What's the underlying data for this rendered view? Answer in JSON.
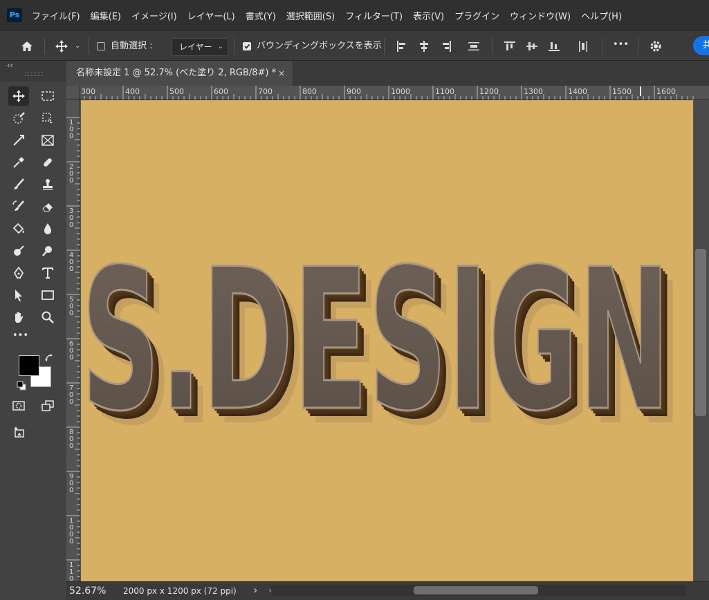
{
  "app": {
    "logo_text": "Ps"
  },
  "menu": [
    "ファイル(F)",
    "編集(E)",
    "イメージ(I)",
    "レイヤー(L)",
    "書式(Y)",
    "選択範囲(S)",
    "フィルター(T)",
    "表示(V)",
    "プラグイン",
    "ウィンドウ(W)",
    "ヘルプ(H)"
  ],
  "options": {
    "auto_select_label": "自動選択 :",
    "auto_select_checked": false,
    "layer_select_value": "レイヤー",
    "bounding_box_label": "バウンディングボックスを表示",
    "bounding_box_checked": true,
    "more_label": "•••",
    "share_label": "共"
  },
  "toolbar": {
    "collapse_label": "‹‹",
    "more_label": "•••"
  },
  "document": {
    "tab_title": "名称未設定 1 @ 52.7% (べた塗り 2, RGB/8#) *",
    "tab_close": "×",
    "canvas_color": "#d7b064",
    "artwork_text": "S.DESIGN"
  },
  "ruler": {
    "top": [
      "300",
      "400",
      "500",
      "600",
      "700",
      "800",
      "900",
      "1000",
      "1100",
      "1200",
      "1300",
      "1400",
      "1500",
      "1600"
    ],
    "left": [
      "1 0 0",
      "2 0 0",
      "3 0 0",
      "4 0 0",
      "5 0 0",
      "6 0 0",
      "7 0 0",
      "8 0 0",
      "9 0 0",
      "1 0 0 0",
      "1 1 0 0"
    ]
  },
  "status": {
    "zoom": "52.67%",
    "doc_size": "2000 px x 1200 px (72 ppi)",
    "arrow_right": "›",
    "arrow_left": "‹"
  },
  "colors": {
    "foreground": "#000000",
    "background": "#ffffff",
    "accent": "#1473e6"
  }
}
